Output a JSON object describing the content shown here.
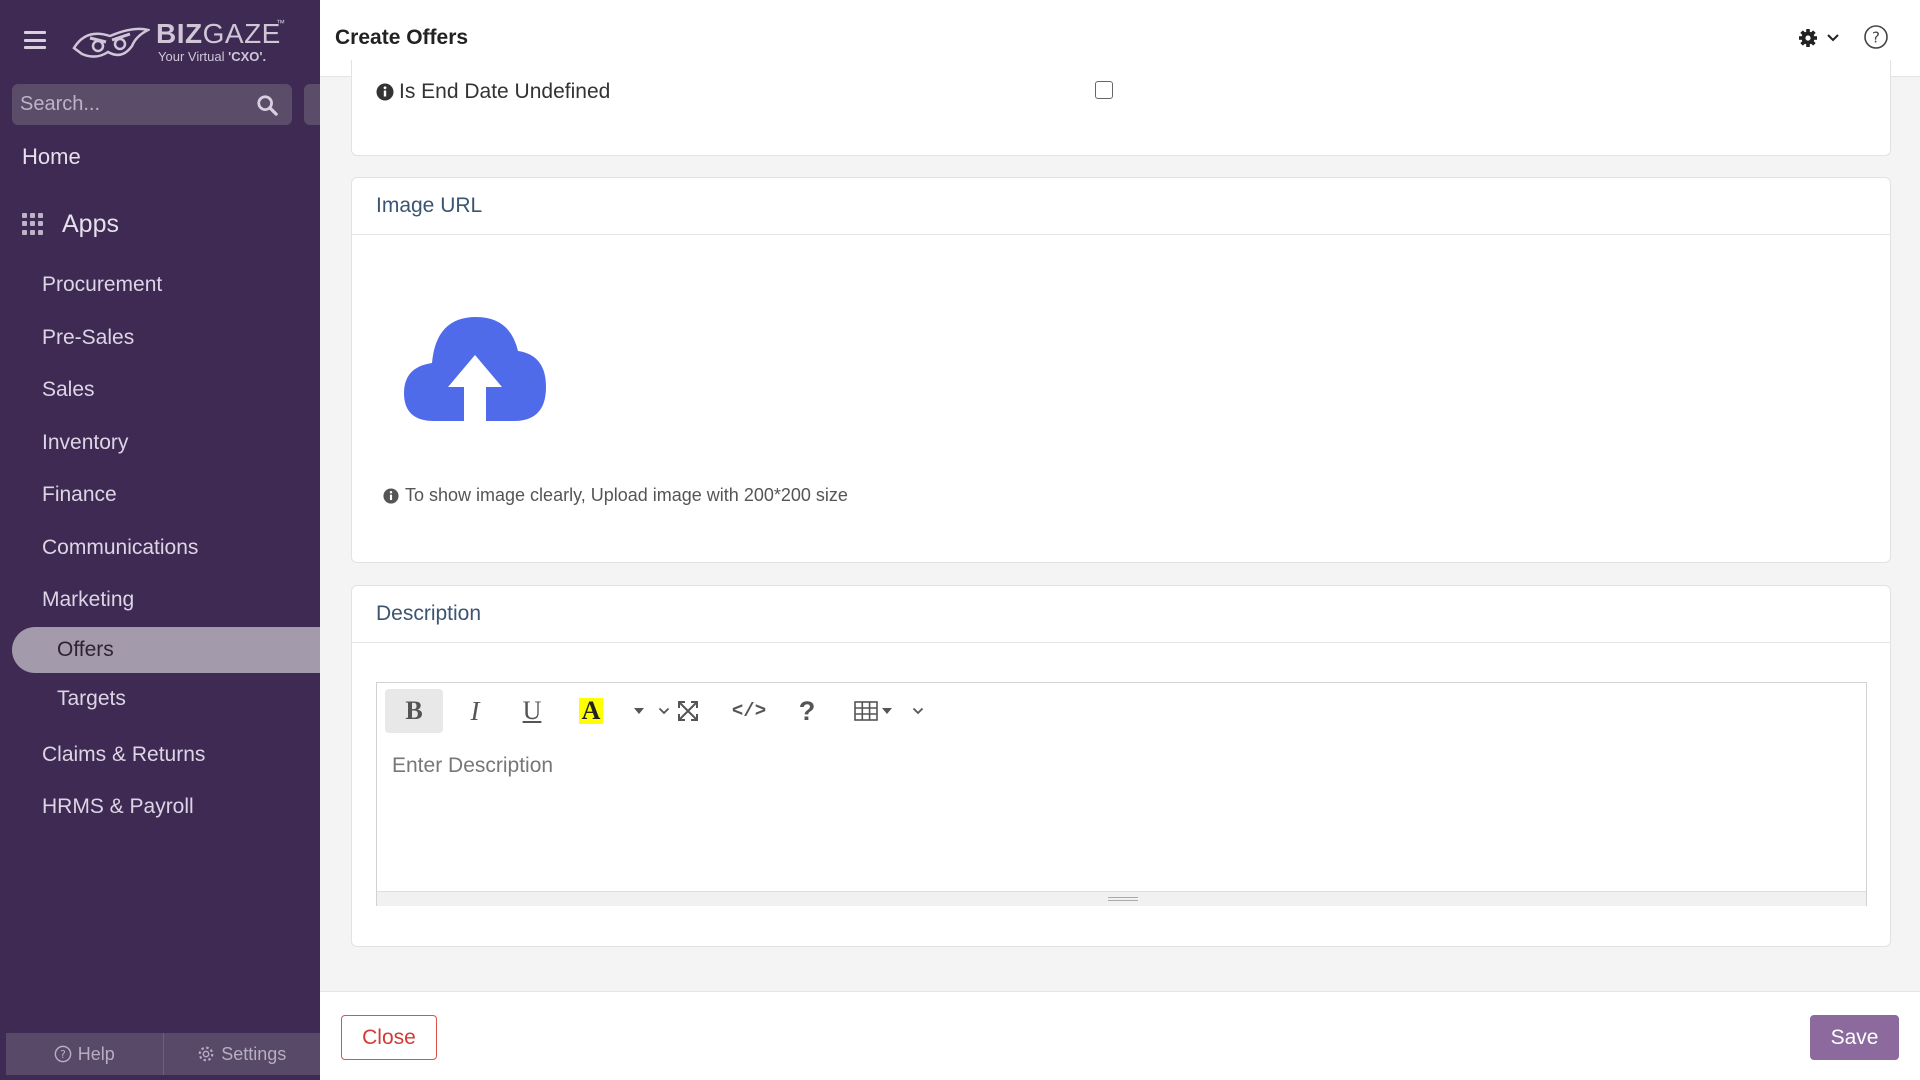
{
  "sidebar": {
    "logo": {
      "brand_bold": "BIZ",
      "brand_light": "GAZE",
      "trademark": "™",
      "tagline_prefix": "Your Virtual ",
      "tagline_bold": "'CXO'."
    },
    "search": {
      "placeholder": "Search..."
    },
    "home_label": "Home",
    "apps_label": "Apps",
    "apps": [
      {
        "label": "Procurement"
      },
      {
        "label": "Pre-Sales"
      },
      {
        "label": "Sales"
      },
      {
        "label": "Inventory"
      },
      {
        "label": "Finance"
      },
      {
        "label": "Communications"
      },
      {
        "label": "Marketing"
      }
    ],
    "marketing_children": [
      {
        "label": "Offers",
        "active": true
      },
      {
        "label": "Targets",
        "active": false
      }
    ],
    "apps_after": [
      {
        "label": "Claims & Returns"
      },
      {
        "label": "HRMS & Payroll"
      }
    ],
    "footer": {
      "help_label": "Help",
      "settings_label": "Settings"
    }
  },
  "header": {
    "title": "Create Offers"
  },
  "form": {
    "end_date_undefined": {
      "label": "Is End Date Undefined",
      "checked": false
    },
    "image_section": {
      "title": "Image URL",
      "hint": "To show image clearly, Upload image with 200*200 size"
    },
    "description_section": {
      "title": "Description",
      "placeholder": "Enter Description",
      "value": ""
    }
  },
  "editor_toolbar": {
    "bold": "B",
    "italic": "I",
    "underline": "U",
    "color": "A",
    "code": "</>",
    "help": "?"
  },
  "footer": {
    "close_label": "Close",
    "save_label": "Save"
  },
  "colors": {
    "sidebar_bg": "#3e2a52",
    "active_item_bg": "#a39aab",
    "upload_icon": "#4f6bea",
    "save_button": "#8c6a9e",
    "close_button": "#d9534f",
    "highlight_yellow": "#ffff00"
  },
  "icons": {
    "menu": "hamburger-icon",
    "search": "search-icon",
    "apps": "grid-icon",
    "gear": "gear-icon",
    "help": "question-circle-icon",
    "info": "info-circle-icon",
    "upload": "cloud-upload-icon",
    "table": "table-icon",
    "fullscreen": "expand-icon"
  }
}
